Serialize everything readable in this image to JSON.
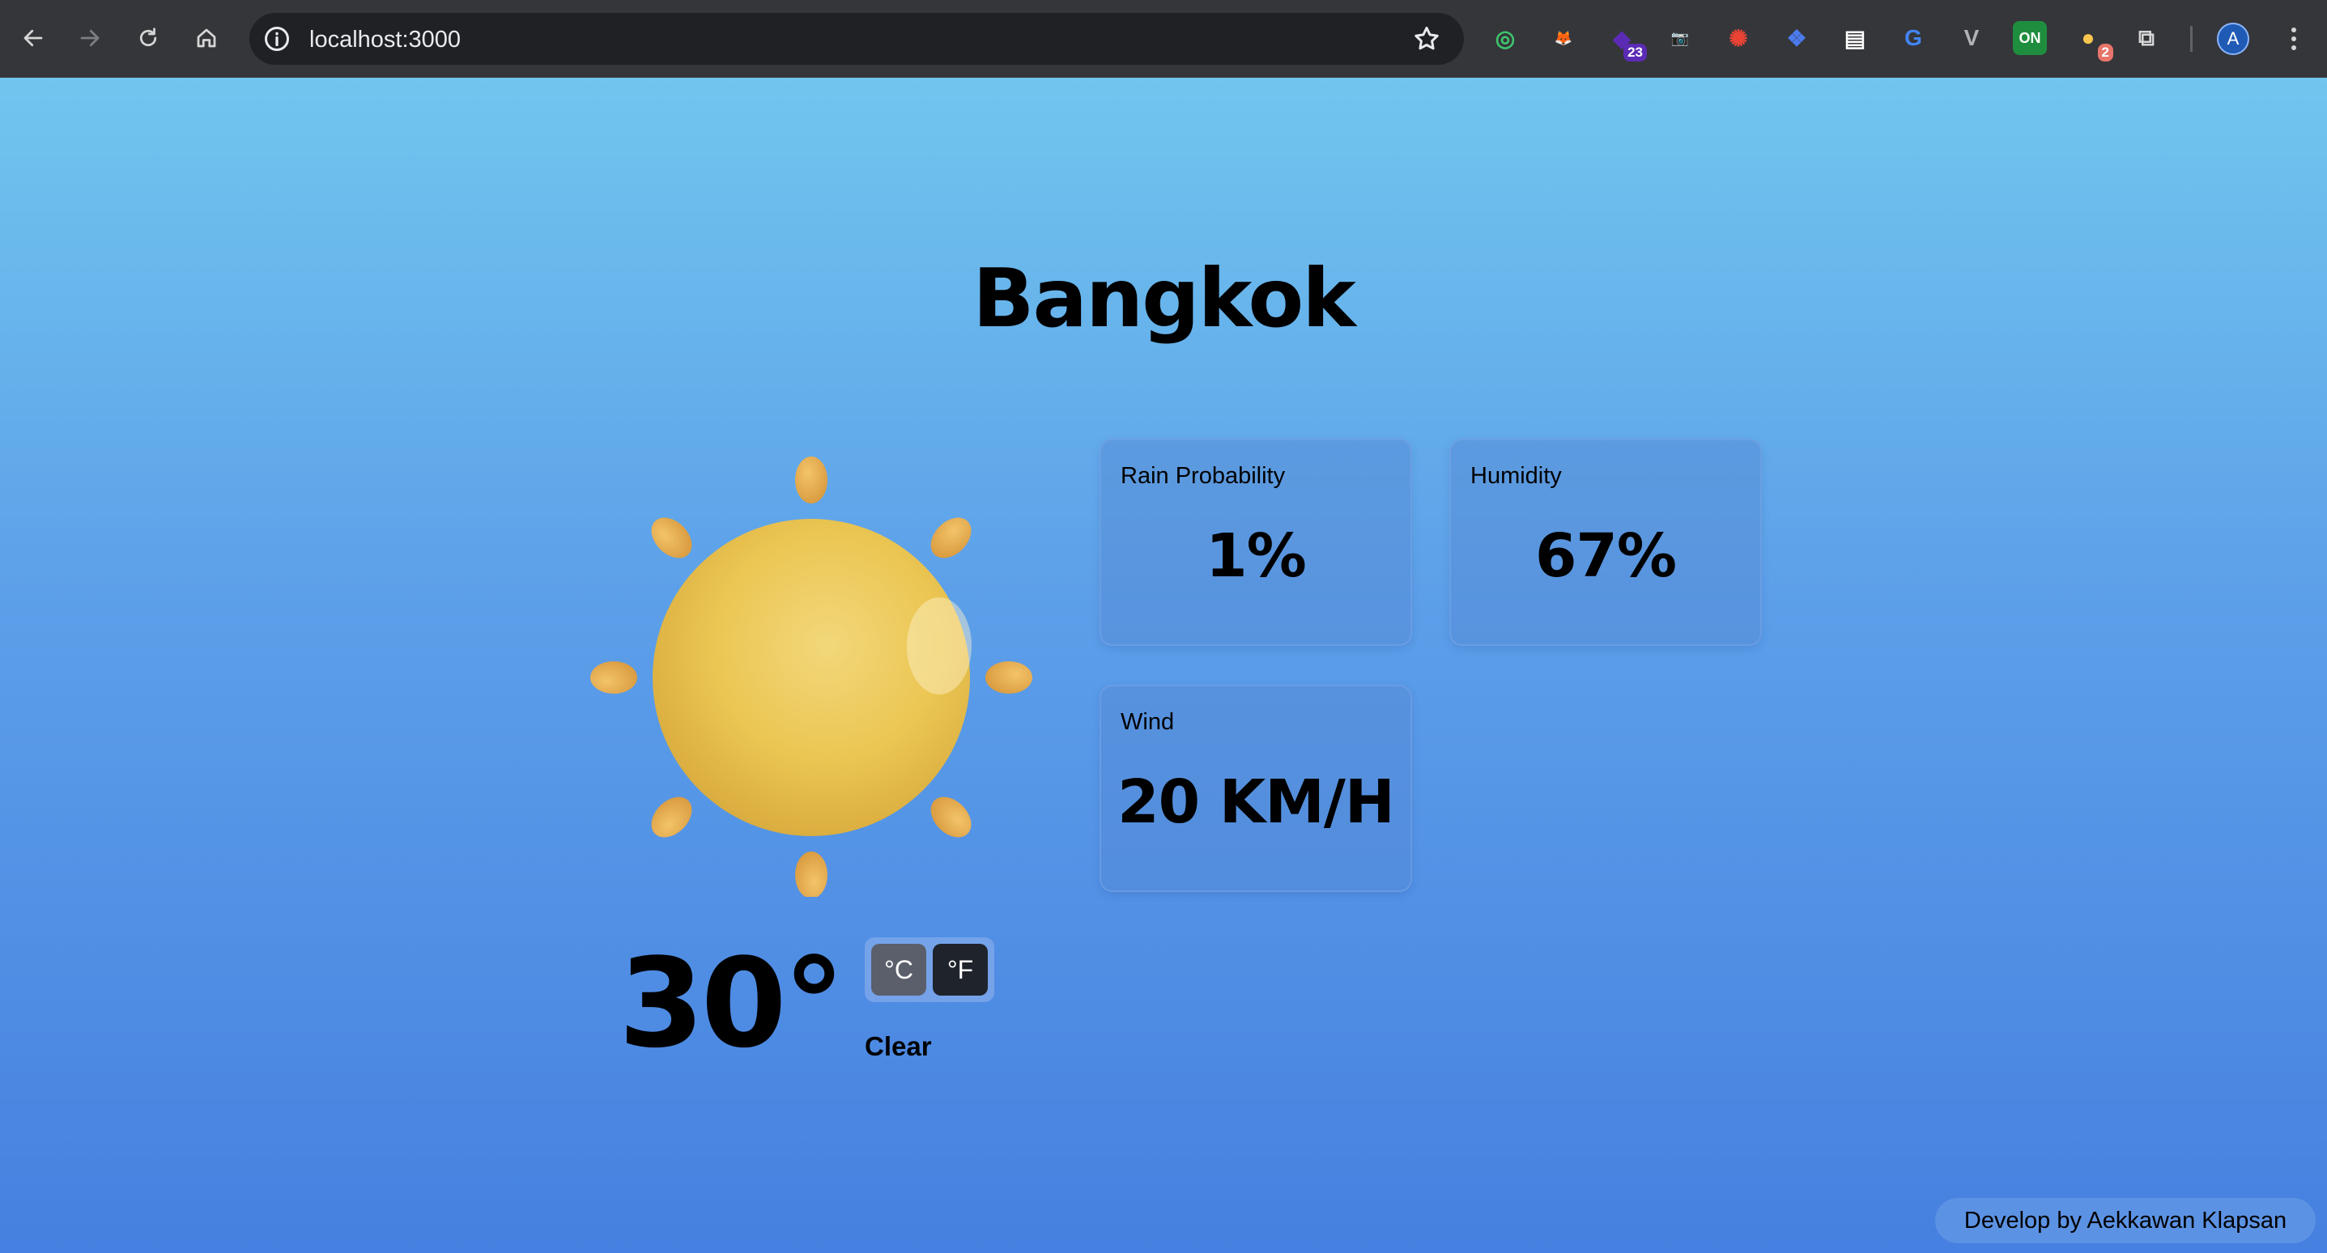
{
  "browser": {
    "url": "localhost:3000",
    "extensions": [
      {
        "name": "target-extension-icon",
        "color": "#3ec46d",
        "glyph": "◎"
      },
      {
        "name": "fox-extension-icon",
        "color": "#e2761b",
        "glyph": "🦊"
      },
      {
        "name": "purple-extension-icon",
        "color": "#5b2bb5",
        "glyph": "◆",
        "badge": "23",
        "badge_color": "#5b2bb5"
      },
      {
        "name": "camera-extension-icon",
        "color": "#9aa0a6",
        "glyph": "📷"
      },
      {
        "name": "color-wheel-extension-icon",
        "color": "#ea4335",
        "glyph": "✺"
      },
      {
        "name": "blue-brackets-extension-icon",
        "color": "#4b7bec",
        "glyph": "❖"
      },
      {
        "name": "ninja-extension-icon",
        "color": "#ffffff",
        "glyph": "▤"
      },
      {
        "name": "translate-extension-icon",
        "color": "#4285f4",
        "glyph": "G"
      },
      {
        "name": "vue-extension-icon",
        "color": "#b0b3b8",
        "glyph": "V"
      },
      {
        "name": "on-extension-icon",
        "color": "#1e8e3e",
        "glyph": "ON"
      },
      {
        "name": "bulbs-extension-icon",
        "color": "#f9c74f",
        "glyph": "●",
        "badge": "2",
        "badge_color": "#e8756a"
      },
      {
        "name": "puzzle-extension-icon",
        "color": "#d6d6d6",
        "glyph": "⧉"
      }
    ],
    "profile_initial": "A"
  },
  "weather": {
    "city": "Bangkok",
    "temperature": "30°",
    "unit_celsius": "°C",
    "unit_fahrenheit": "°F",
    "selected_unit": "°F",
    "condition": "Clear",
    "icon": "sun-icon",
    "cards": [
      {
        "label": "Rain Probability",
        "value": "1%"
      },
      {
        "label": "Humidity",
        "value": "67%"
      },
      {
        "label": "Wind",
        "value": "20 KM/H"
      }
    ]
  },
  "footer": {
    "credit": "Develop by Aekkawan Klapsan"
  },
  "colors": {
    "gradient_top": "#71c5ee",
    "gradient_bottom": "#4680e0",
    "sun": "#ecc34a",
    "sun_rays": "#e5a94a"
  }
}
